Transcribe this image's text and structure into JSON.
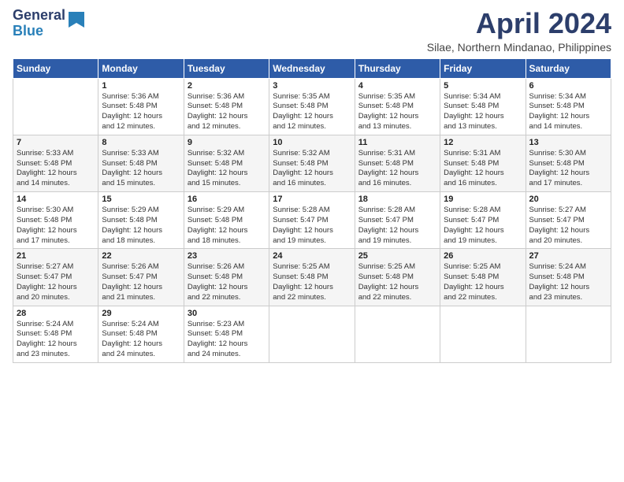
{
  "header": {
    "logo_general": "General",
    "logo_blue": "Blue",
    "month_title": "April 2024",
    "location": "Silae, Northern Mindanao, Philippines"
  },
  "weekdays": [
    "Sunday",
    "Monday",
    "Tuesday",
    "Wednesday",
    "Thursday",
    "Friday",
    "Saturday"
  ],
  "weeks": [
    [
      {
        "day": "",
        "info": ""
      },
      {
        "day": "1",
        "info": "Sunrise: 5:36 AM\nSunset: 5:48 PM\nDaylight: 12 hours\nand 12 minutes."
      },
      {
        "day": "2",
        "info": "Sunrise: 5:36 AM\nSunset: 5:48 PM\nDaylight: 12 hours\nand 12 minutes."
      },
      {
        "day": "3",
        "info": "Sunrise: 5:35 AM\nSunset: 5:48 PM\nDaylight: 12 hours\nand 12 minutes."
      },
      {
        "day": "4",
        "info": "Sunrise: 5:35 AM\nSunset: 5:48 PM\nDaylight: 12 hours\nand 13 minutes."
      },
      {
        "day": "5",
        "info": "Sunrise: 5:34 AM\nSunset: 5:48 PM\nDaylight: 12 hours\nand 13 minutes."
      },
      {
        "day": "6",
        "info": "Sunrise: 5:34 AM\nSunset: 5:48 PM\nDaylight: 12 hours\nand 14 minutes."
      }
    ],
    [
      {
        "day": "7",
        "info": "Sunrise: 5:33 AM\nSunset: 5:48 PM\nDaylight: 12 hours\nand 14 minutes."
      },
      {
        "day": "8",
        "info": "Sunrise: 5:33 AM\nSunset: 5:48 PM\nDaylight: 12 hours\nand 15 minutes."
      },
      {
        "day": "9",
        "info": "Sunrise: 5:32 AM\nSunset: 5:48 PM\nDaylight: 12 hours\nand 15 minutes."
      },
      {
        "day": "10",
        "info": "Sunrise: 5:32 AM\nSunset: 5:48 PM\nDaylight: 12 hours\nand 16 minutes."
      },
      {
        "day": "11",
        "info": "Sunrise: 5:31 AM\nSunset: 5:48 PM\nDaylight: 12 hours\nand 16 minutes."
      },
      {
        "day": "12",
        "info": "Sunrise: 5:31 AM\nSunset: 5:48 PM\nDaylight: 12 hours\nand 16 minutes."
      },
      {
        "day": "13",
        "info": "Sunrise: 5:30 AM\nSunset: 5:48 PM\nDaylight: 12 hours\nand 17 minutes."
      }
    ],
    [
      {
        "day": "14",
        "info": "Sunrise: 5:30 AM\nSunset: 5:48 PM\nDaylight: 12 hours\nand 17 minutes."
      },
      {
        "day": "15",
        "info": "Sunrise: 5:29 AM\nSunset: 5:48 PM\nDaylight: 12 hours\nand 18 minutes."
      },
      {
        "day": "16",
        "info": "Sunrise: 5:29 AM\nSunset: 5:48 PM\nDaylight: 12 hours\nand 18 minutes."
      },
      {
        "day": "17",
        "info": "Sunrise: 5:28 AM\nSunset: 5:47 PM\nDaylight: 12 hours\nand 19 minutes."
      },
      {
        "day": "18",
        "info": "Sunrise: 5:28 AM\nSunset: 5:47 PM\nDaylight: 12 hours\nand 19 minutes."
      },
      {
        "day": "19",
        "info": "Sunrise: 5:28 AM\nSunset: 5:47 PM\nDaylight: 12 hours\nand 19 minutes."
      },
      {
        "day": "20",
        "info": "Sunrise: 5:27 AM\nSunset: 5:47 PM\nDaylight: 12 hours\nand 20 minutes."
      }
    ],
    [
      {
        "day": "21",
        "info": "Sunrise: 5:27 AM\nSunset: 5:47 PM\nDaylight: 12 hours\nand 20 minutes."
      },
      {
        "day": "22",
        "info": "Sunrise: 5:26 AM\nSunset: 5:47 PM\nDaylight: 12 hours\nand 21 minutes."
      },
      {
        "day": "23",
        "info": "Sunrise: 5:26 AM\nSunset: 5:48 PM\nDaylight: 12 hours\nand 22 minutes."
      },
      {
        "day": "24",
        "info": "Sunrise: 5:25 AM\nSunset: 5:48 PM\nDaylight: 12 hours\nand 22 minutes."
      },
      {
        "day": "25",
        "info": "Sunrise: 5:25 AM\nSunset: 5:48 PM\nDaylight: 12 hours\nand 22 minutes."
      },
      {
        "day": "26",
        "info": "Sunrise: 5:25 AM\nSunset: 5:48 PM\nDaylight: 12 hours\nand 22 minutes."
      },
      {
        "day": "27",
        "info": "Sunrise: 5:24 AM\nSunset: 5:48 PM\nDaylight: 12 hours\nand 23 minutes."
      }
    ],
    [
      {
        "day": "28",
        "info": "Sunrise: 5:24 AM\nSunset: 5:48 PM\nDaylight: 12 hours\nand 23 minutes."
      },
      {
        "day": "29",
        "info": "Sunrise: 5:24 AM\nSunset: 5:48 PM\nDaylight: 12 hours\nand 24 minutes."
      },
      {
        "day": "30",
        "info": "Sunrise: 5:23 AM\nSunset: 5:48 PM\nDaylight: 12 hours\nand 24 minutes."
      },
      {
        "day": "",
        "info": ""
      },
      {
        "day": "",
        "info": ""
      },
      {
        "day": "",
        "info": ""
      },
      {
        "day": "",
        "info": ""
      }
    ]
  ]
}
